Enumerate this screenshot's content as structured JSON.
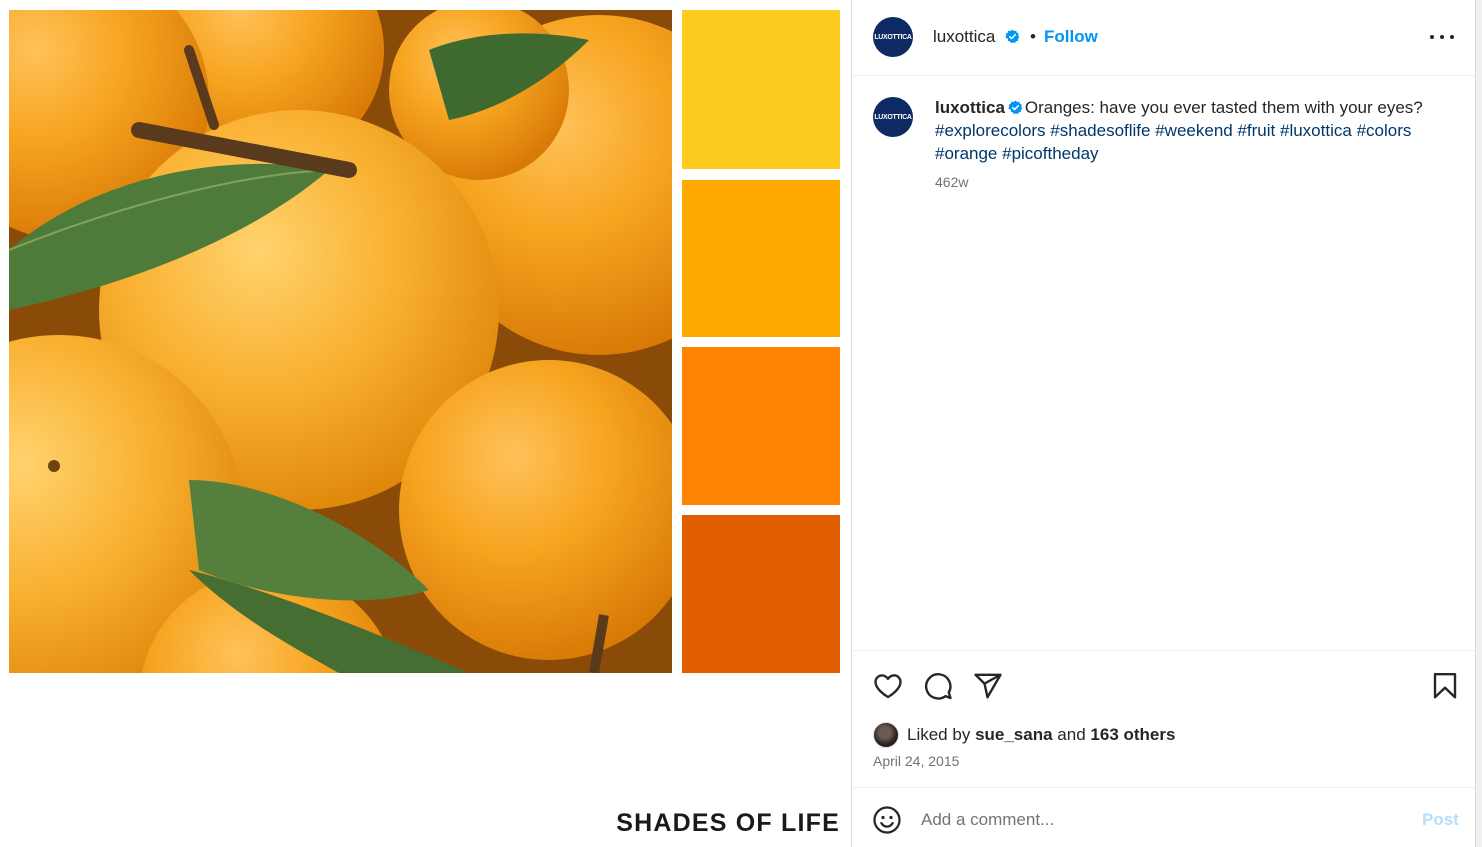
{
  "post": {
    "username": "luxottica",
    "avatar_text": "LUXOTTICA",
    "follow_label": "Follow",
    "separator": "•",
    "caption": {
      "text": "Oranges: have you ever tasted them with your eyes?",
      "hashtags": [
        "#explorecolors",
        "#shadesoflife",
        "#weekend",
        "#fruit",
        "#luxottica",
        "#colors",
        "#orange",
        "#picoftheday"
      ],
      "age": "462w"
    },
    "likes": {
      "prefix": "Liked by",
      "liker": "sue_sana",
      "middle": "and",
      "others": "163 others"
    },
    "date": "April 24, 2015",
    "comment": {
      "placeholder": "Add a comment...",
      "post_label": "Post"
    }
  },
  "media": {
    "overlay_title": "SHADES OF LIFE",
    "swatches": [
      "#fdcc1f",
      "#fea900",
      "#fd8300",
      "#e15e00"
    ]
  },
  "icons": {
    "verified": "verified-badge-icon",
    "more": "more-options-icon",
    "like": "heart-icon",
    "comment": "comment-bubble-icon",
    "share": "paper-plane-icon",
    "save": "bookmark-icon",
    "emoji": "emoji-icon"
  },
  "colors": {
    "accent": "#0095f6",
    "hashtag": "#00376b",
    "verified": "#0095f6",
    "muted": "#737373"
  }
}
